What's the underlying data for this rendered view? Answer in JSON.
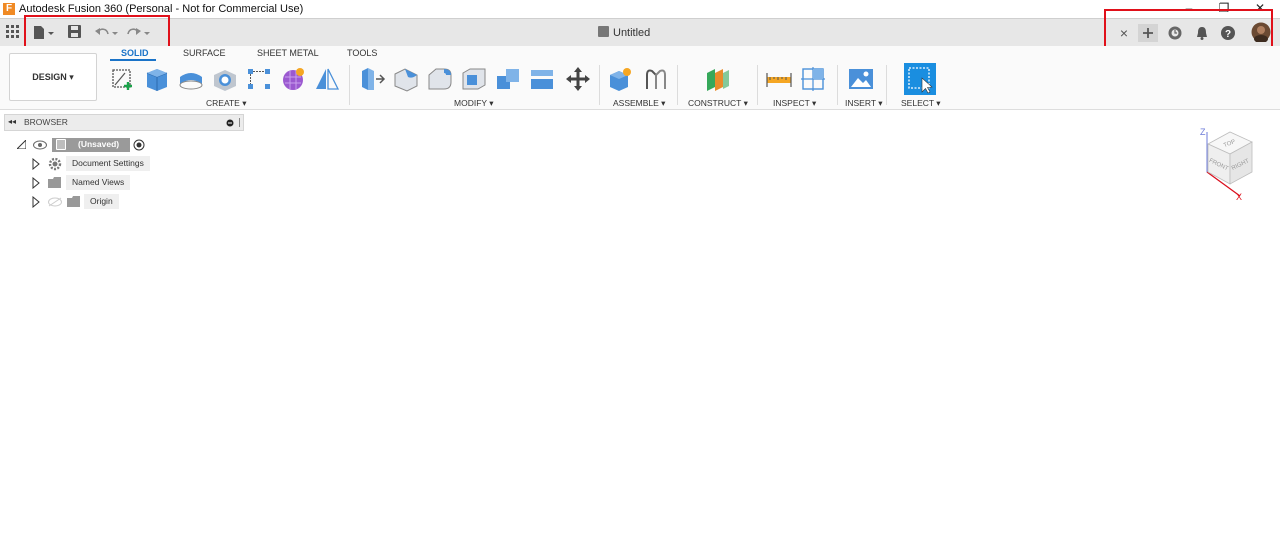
{
  "window": {
    "title": "Autodesk Fusion 360 (Personal - Not for Commercial Use)",
    "logo_letter": "F",
    "minimize": "–",
    "restore": "❐",
    "close": "✕"
  },
  "qat": {
    "icons": [
      "grid-icon",
      "file-icon",
      "save-icon",
      "undo-icon",
      "redo-icon"
    ]
  },
  "document_tab": {
    "name": "Untitled",
    "close": "×"
  },
  "right_icons": [
    "close-tab-icon",
    "new-tab-icon",
    "job-status-icon",
    "notifications-icon",
    "help-icon",
    "profile-avatar"
  ],
  "ribbon": {
    "workspace": "DESIGN ▾",
    "tabs": [
      "SOLID",
      "SURFACE",
      "SHEET METAL",
      "TOOLS"
    ],
    "active_tab": "SOLID",
    "groups": [
      {
        "label": "CREATE ▾"
      },
      {
        "label": "MODIFY ▾"
      },
      {
        "label": "ASSEMBLE ▾"
      },
      {
        "label": "CONSTRUCT ▾"
      },
      {
        "label": "INSPECT ▾"
      },
      {
        "label": "INSERT ▾"
      },
      {
        "label": "SELECT ▾"
      }
    ]
  },
  "browser": {
    "title": "BROWSER",
    "collapse": "◂◂",
    "root": "(Unsaved)",
    "items": [
      {
        "label": "Document Settings"
      },
      {
        "label": "Named Views"
      },
      {
        "label": "Origin"
      }
    ]
  },
  "viewcube": {
    "z_label": "Z",
    "x_label": "X",
    "top": "TOP",
    "front": "FRONT",
    "right": "RIGHT"
  },
  "colors": {
    "accent": "#1a73c8",
    "highlight": "#e0101a",
    "ribbon_blue": "#4a90d9"
  }
}
